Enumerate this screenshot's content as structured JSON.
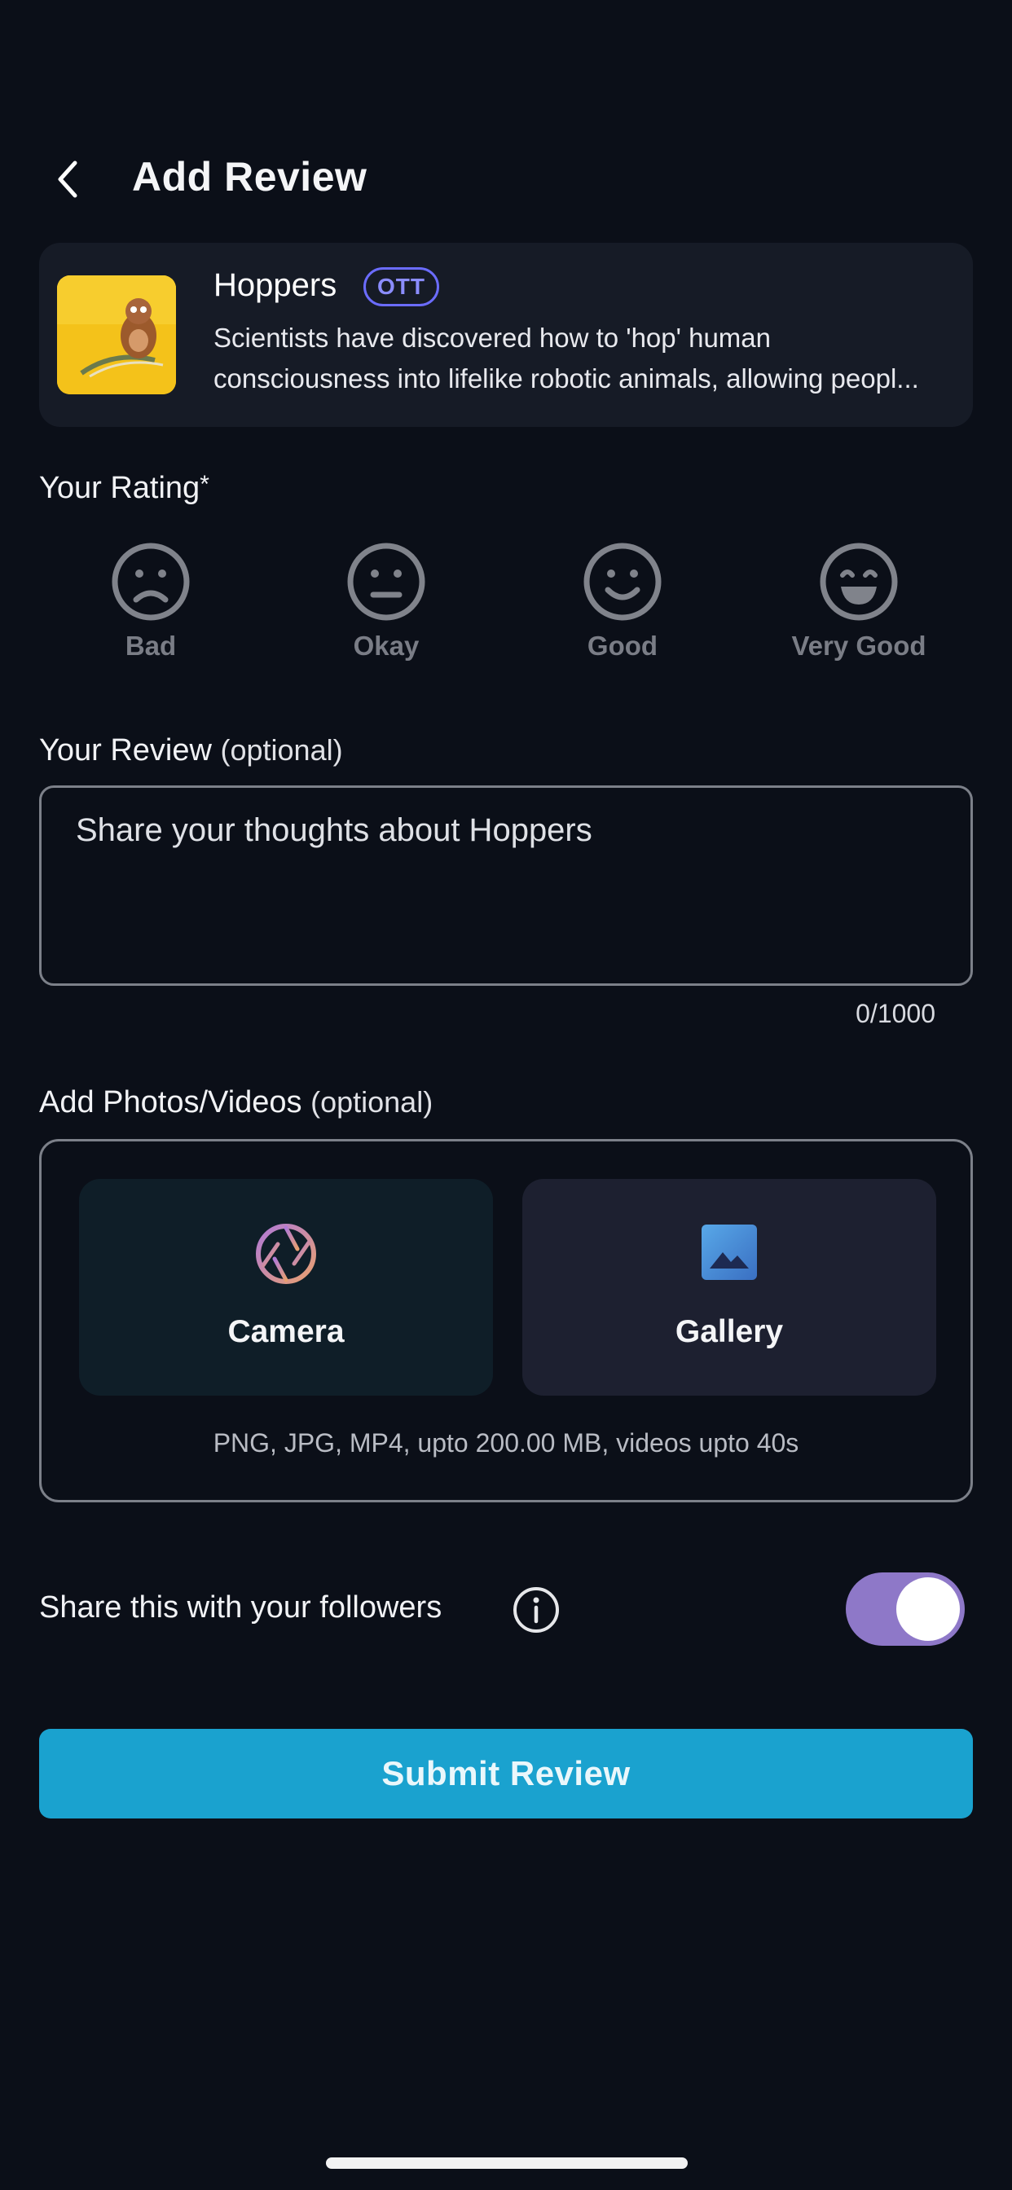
{
  "header": {
    "title": "Add Review",
    "back_icon": "chevron-left-icon"
  },
  "movie": {
    "title": "Hoppers",
    "badge": "OTT",
    "description_line1": "Scientists have discovered how to 'hop' human",
    "description_line2": "consciousness into lifelike robotic animals, allowing peopl..."
  },
  "rating": {
    "label": "Your Rating",
    "required_mark": "*",
    "options": [
      {
        "label": "Bad",
        "icon": "sad-face-icon"
      },
      {
        "label": "Okay",
        "icon": "neutral-face-icon"
      },
      {
        "label": "Good",
        "icon": "smile-face-icon"
      },
      {
        "label": "Very Good",
        "icon": "grin-face-icon"
      }
    ]
  },
  "review": {
    "label": "Your Review",
    "optional": "(optional)",
    "placeholder": "Share your thoughts about Hoppers",
    "char_count": "0/1000"
  },
  "media": {
    "label": "Add Photos/Videos",
    "optional": "(optional)",
    "camera_label": "Camera",
    "gallery_label": "Gallery",
    "note": "PNG, JPG, MP4, upto 200.00 MB, videos upto 40s"
  },
  "share": {
    "label": "Share this with your followers",
    "toggle_on": true
  },
  "submit_label": "Submit Review",
  "colors": {
    "background": "#0b0f18",
    "card": "#161b26",
    "accent": "#1aa2cf",
    "toggle": "#8e78c8",
    "badge": "#6b6cff"
  }
}
